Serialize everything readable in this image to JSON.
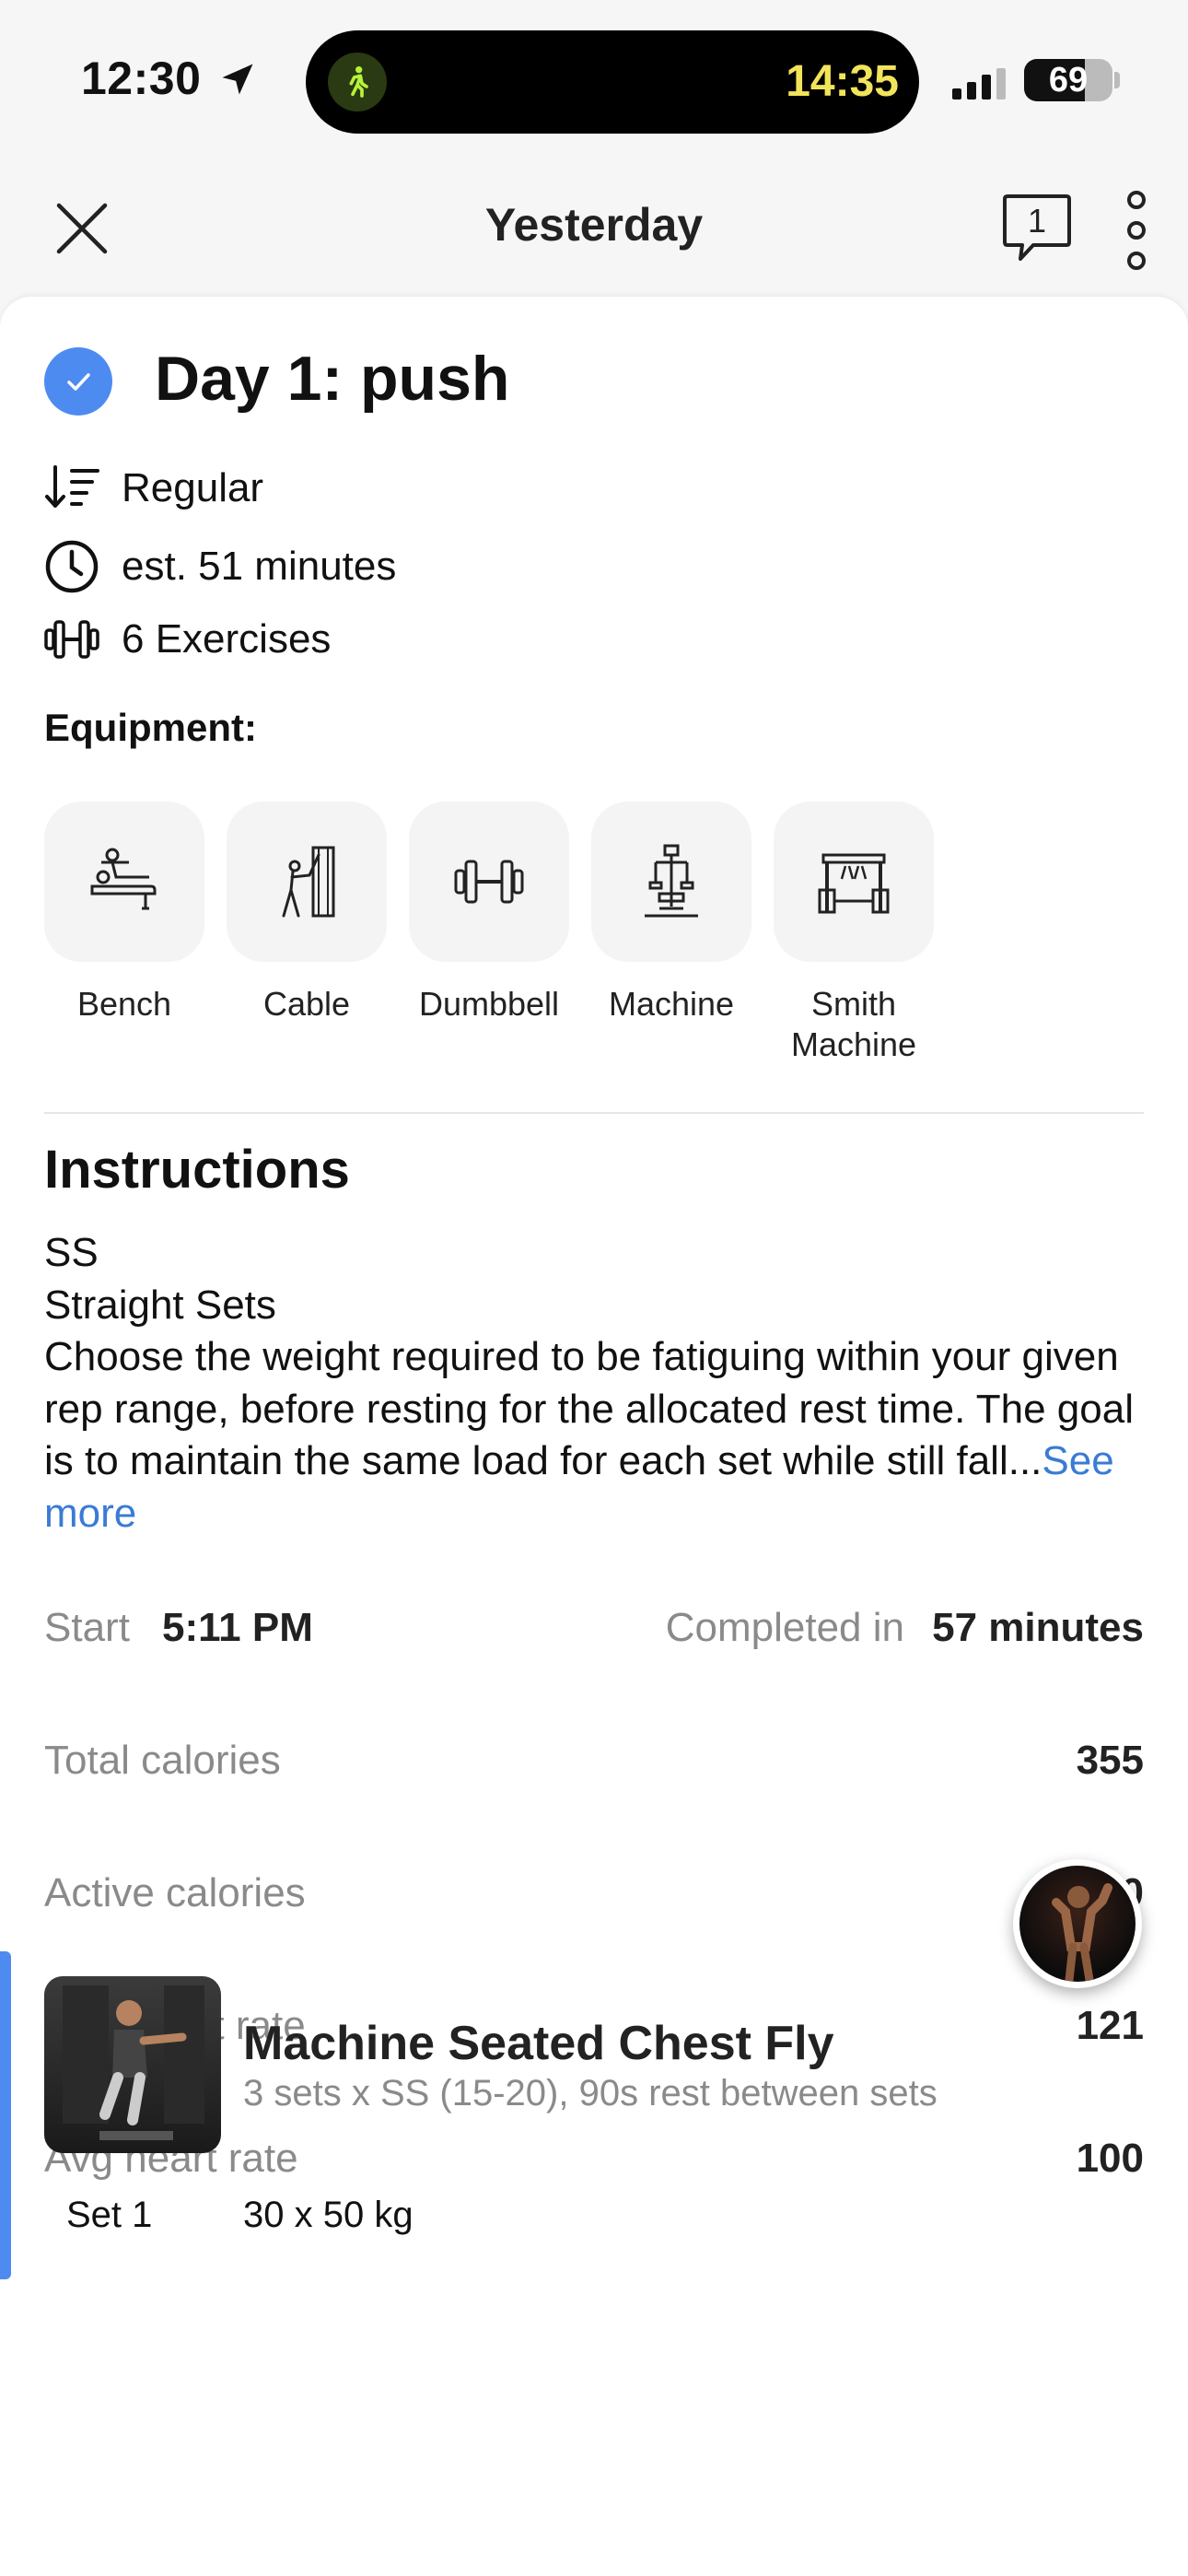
{
  "status_bar": {
    "time": "12:30",
    "live_activity_timer": "14:35",
    "battery_level": "69",
    "battery_fraction": 0.69
  },
  "nav": {
    "title": "Yesterday",
    "comments_count": "1"
  },
  "workout": {
    "title": "Day 1: push",
    "meta": [
      {
        "icon": "sort-icon",
        "text": "Regular"
      },
      {
        "icon": "clock-icon",
        "text": "est. 51 minutes"
      },
      {
        "icon": "dumbbell-icon",
        "text": "6 Exercises"
      }
    ],
    "equipment_heading": "Equipment:",
    "equipment": [
      {
        "icon": "bench-icon",
        "line1": "Bench",
        "line2": ""
      },
      {
        "icon": "cable-icon",
        "line1": "Cable",
        "line2": ""
      },
      {
        "icon": "dumbbell-icon",
        "line1": "Dumbbell",
        "line2": ""
      },
      {
        "icon": "machine-icon",
        "line1": "Machine",
        "line2": ""
      },
      {
        "icon": "smith-machine-icon",
        "line1": "Smith",
        "line2": "Machine"
      }
    ]
  },
  "instructions": {
    "title": "Instructions",
    "line1": "SS",
    "line2": "Straight Sets",
    "body": "Choose the weight required to be fatiguing within your given rep range, before resting for the allocated rest time. The goal is to maintain the same load for each set while still fall...",
    "see_more": "See more"
  },
  "stats": {
    "start_label": "Start",
    "start_value": "5:11 PM",
    "completed_label": "Completed in",
    "completed_value": "57 minutes",
    "rows": [
      {
        "label": "Total calories",
        "value": "355"
      },
      {
        "label": "Active calories",
        "value": "260"
      },
      {
        "label": "Max heart rate",
        "value": "121"
      },
      {
        "label": "Avg heart rate",
        "value": "100"
      }
    ]
  },
  "exercise": {
    "name": "Machine Seated Chest Fly",
    "description": "3 sets x SS (15-20), 90s rest between sets",
    "set_label": "Set 1",
    "set_value": "30 x 50 kg"
  },
  "colors": {
    "accent": "#4d8bf0",
    "link": "#3a7bd5",
    "timer": "#f2e45a",
    "muted": "#8a8a8a"
  }
}
